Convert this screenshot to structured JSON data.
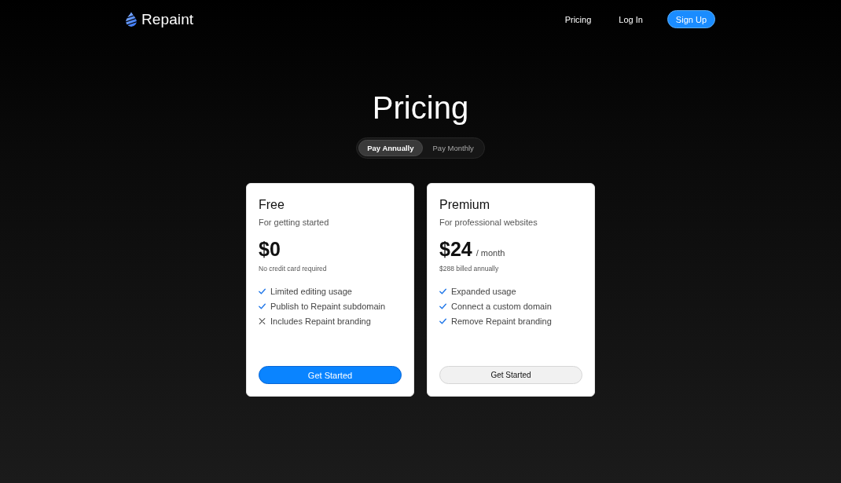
{
  "nav": {
    "brand": "Repaint",
    "links": [
      "Pricing",
      "Log In"
    ],
    "cta": "Sign Up"
  },
  "heading": "Pricing",
  "billing_toggle": [
    {
      "label": "Pay Annually",
      "selected": true
    },
    {
      "label": "Pay Monthly",
      "selected": false
    }
  ],
  "plans": [
    {
      "name": "Free",
      "tagline": "For getting started",
      "price": "$0",
      "note": "No credit card required",
      "features": [
        {
          "text": "Limited editing usage",
          "included": true
        },
        {
          "text": "Publish to Repaint subdomain",
          "included": true
        },
        {
          "text": "Includes Repaint branding",
          "included": false
        }
      ],
      "button": {
        "label": "Get Started",
        "kind": "primary"
      }
    },
    {
      "name": "Premium",
      "tagline": "For professional websites",
      "price": "$24",
      "period": "/ month",
      "note": "$288 billed annually",
      "features": [
        {
          "text": "Expanded usage",
          "included": true
        },
        {
          "text": "Connect a custom domain",
          "included": true
        },
        {
          "text": "Remove Repaint branding",
          "included": true
        }
      ],
      "button": {
        "label": "Get Started",
        "kind": "secondary"
      }
    }
  ]
}
